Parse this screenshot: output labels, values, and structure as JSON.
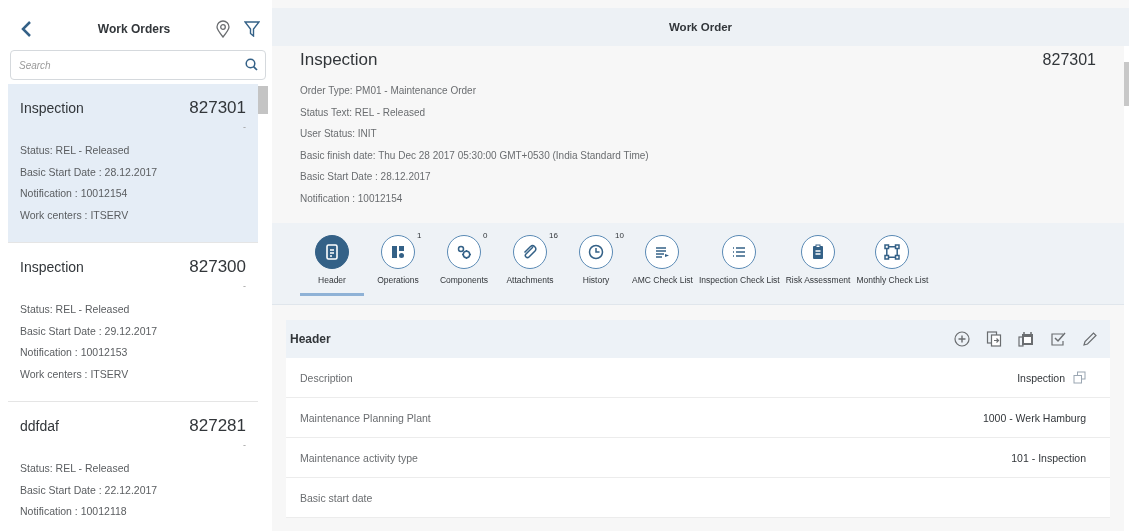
{
  "master": {
    "title": "Work Orders",
    "search": {
      "placeholder": "Search"
    },
    "items": [
      {
        "title": "Inspection",
        "number": "827301",
        "marker": "-",
        "selected": true,
        "details": [
          "Status: REL - Released",
          "Basic Start Date : 28.12.2017",
          "Notification : 10012154",
          "Work centers : ITSERV"
        ]
      },
      {
        "title": "Inspection",
        "number": "827300",
        "marker": "-",
        "selected": false,
        "details": [
          "Status: REL - Released",
          "Basic Start Date : 29.12.2017",
          "Notification : 10012153",
          "Work centers : ITSERV"
        ]
      },
      {
        "title": "ddfdaf",
        "number": "827281",
        "marker": "-",
        "selected": false,
        "details": [
          "Status: REL - Released",
          "Basic Start Date : 22.12.2017",
          "Notification : 10012118"
        ]
      }
    ]
  },
  "detail": {
    "title": "Work Order",
    "object": {
      "title": "Inspection",
      "number": "827301",
      "attributes": [
        "Order Type: PM01 - Maintenance Order",
        "Status Text: REL - Released",
        "User Status: INIT",
        "Basic finish date: Thu Dec 28 2017 05:30:00 GMT+0530 (India Standard Time)",
        "Basic Start Date : 28.12.2017",
        "Notification : 10012154"
      ]
    },
    "tabs": [
      {
        "kind": "document",
        "label": "Header",
        "selected": true
      },
      {
        "kind": "blocks",
        "label": "Operations",
        "count": "1",
        "selected": false
      },
      {
        "kind": "gears",
        "label": "Components",
        "count": "0",
        "selected": false
      },
      {
        "kind": "paperclip",
        "label": "Attachments",
        "count": "16",
        "selected": false
      },
      {
        "kind": "clock",
        "label": "History",
        "count": "10",
        "selected": false
      },
      {
        "kind": "list-arrow",
        "label": "AMC Check List",
        "selected": false
      },
      {
        "kind": "list",
        "label": "Inspection Check List",
        "selected": false
      },
      {
        "kind": "clipboard",
        "label": "Risk Assessment",
        "selected": false
      },
      {
        "kind": "flow",
        "label": "Monthly Check List",
        "selected": false
      }
    ],
    "section": {
      "title": "Header",
      "fields": [
        {
          "kind": "link",
          "label": "Description",
          "value": "Inspection"
        },
        {
          "kind": "text",
          "label": "Maintenance Planning Plant",
          "value": "1000 - Werk Hamburg"
        },
        {
          "kind": "text",
          "label": "Maintenance activity type",
          "value": "101 - Inspection"
        },
        {
          "label": "Basic start date"
        }
      ]
    }
  }
}
